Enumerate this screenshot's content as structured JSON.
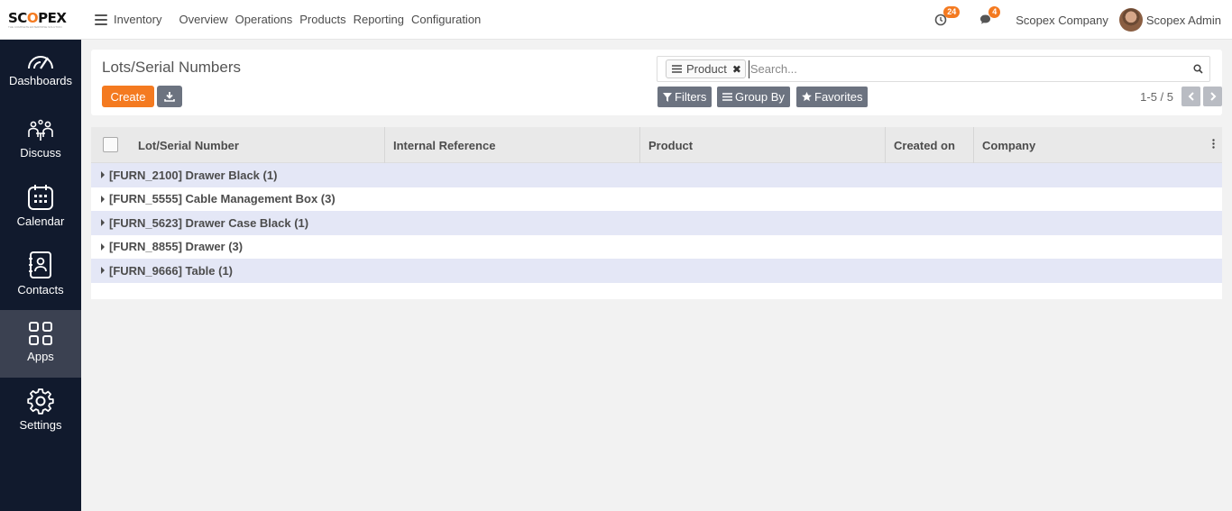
{
  "brand": {
    "logo_pre": "SC",
    "logo_o": "O",
    "logo_post": "PEX",
    "tagline": "THE COMPLETE ENTERPRISE SOLUTION"
  },
  "topbar": {
    "app_name": "Inventory",
    "menu": [
      "Overview",
      "Operations",
      "Products",
      "Reporting",
      "Configuration"
    ],
    "activity_count": "24",
    "message_count": "4",
    "company": "Scopex Company",
    "user": "Scopex Admin"
  },
  "sidebar": {
    "items": [
      {
        "label": "Dashboards",
        "icon": "speedometer-icon"
      },
      {
        "label": "Discuss",
        "icon": "people-discussion-icon"
      },
      {
        "label": "Calendar",
        "icon": "calendar-icon"
      },
      {
        "label": "Contacts",
        "icon": "address-book-icon"
      },
      {
        "label": "Apps",
        "icon": "grid-icon",
        "active": true
      },
      {
        "label": "Settings",
        "icon": "gear-icon"
      }
    ]
  },
  "control": {
    "title": "Lots/Serial Numbers",
    "create_label": "Create",
    "search": {
      "facet_value": "Product",
      "placeholder": "Search..."
    },
    "filters_label": "Filters",
    "groupby_label": "Group By",
    "favorites_label": "Favorites",
    "pager": "1-5 / 5"
  },
  "table": {
    "columns": [
      "Lot/Serial Number",
      "Internal Reference",
      "Product",
      "Created on",
      "Company"
    ],
    "groups": [
      "[FURN_2100] Drawer Black (1)",
      "[FURN_5555] Cable Management Box (3)",
      "[FURN_5623] Drawer Case Black (1)",
      "[FURN_8855] Drawer (3)",
      "[FURN_9666] Table (1)"
    ]
  },
  "colors": {
    "accent": "#f47a20",
    "sidebar": "#111a2d",
    "sidebar_active": "#3b4151",
    "group_row": "#e4e7f6",
    "button_secondary": "#6c7380"
  }
}
